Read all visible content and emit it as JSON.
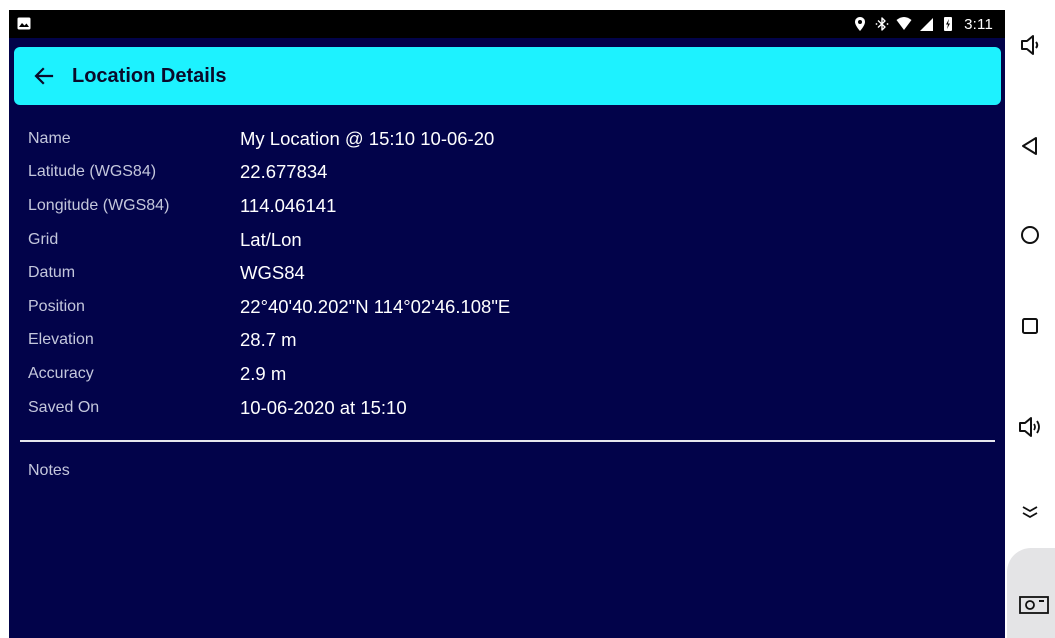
{
  "status_bar": {
    "time": "3:11",
    "icons": [
      "image-icon",
      "location-pin-icon",
      "bluetooth-icon",
      "wifi-icon",
      "cell-signal-icon",
      "battery-charging-icon"
    ]
  },
  "app_bar": {
    "title": "Location Details",
    "back_icon": "arrow-back-icon",
    "background": "#1df2ff"
  },
  "details": [
    {
      "label": "Name",
      "value": "My Location @ 15:10 10-06-20"
    },
    {
      "label": "Latitude (WGS84)",
      "value": "22.677834"
    },
    {
      "label": "Longitude (WGS84)",
      "value": "114.046141"
    },
    {
      "label": "Grid",
      "value": "Lat/Lon"
    },
    {
      "label": "Datum",
      "value": "WGS84"
    },
    {
      "label": "Position",
      "value": "22°40'40.202\"N 114°02'46.108\"E"
    },
    {
      "label": "Elevation",
      "value": "28.7 m"
    },
    {
      "label": "Accuracy",
      "value": "2.9 m"
    },
    {
      "label": "Saved On",
      "value": "10-06-2020 at 15:10"
    }
  ],
  "notes": {
    "label": "Notes"
  },
  "nav_bar": {
    "buttons": [
      "volume-down-icon",
      "back-triangle-icon",
      "home-circle-icon",
      "recents-square-icon",
      "volume-up-icon",
      "collapse-chevron-icon",
      "screenshot-icon"
    ]
  },
  "colors": {
    "screen_background": "#02034a",
    "accent": "#1df2ff",
    "label_text": "#c4c7dc",
    "value_text": "#ffffff"
  }
}
